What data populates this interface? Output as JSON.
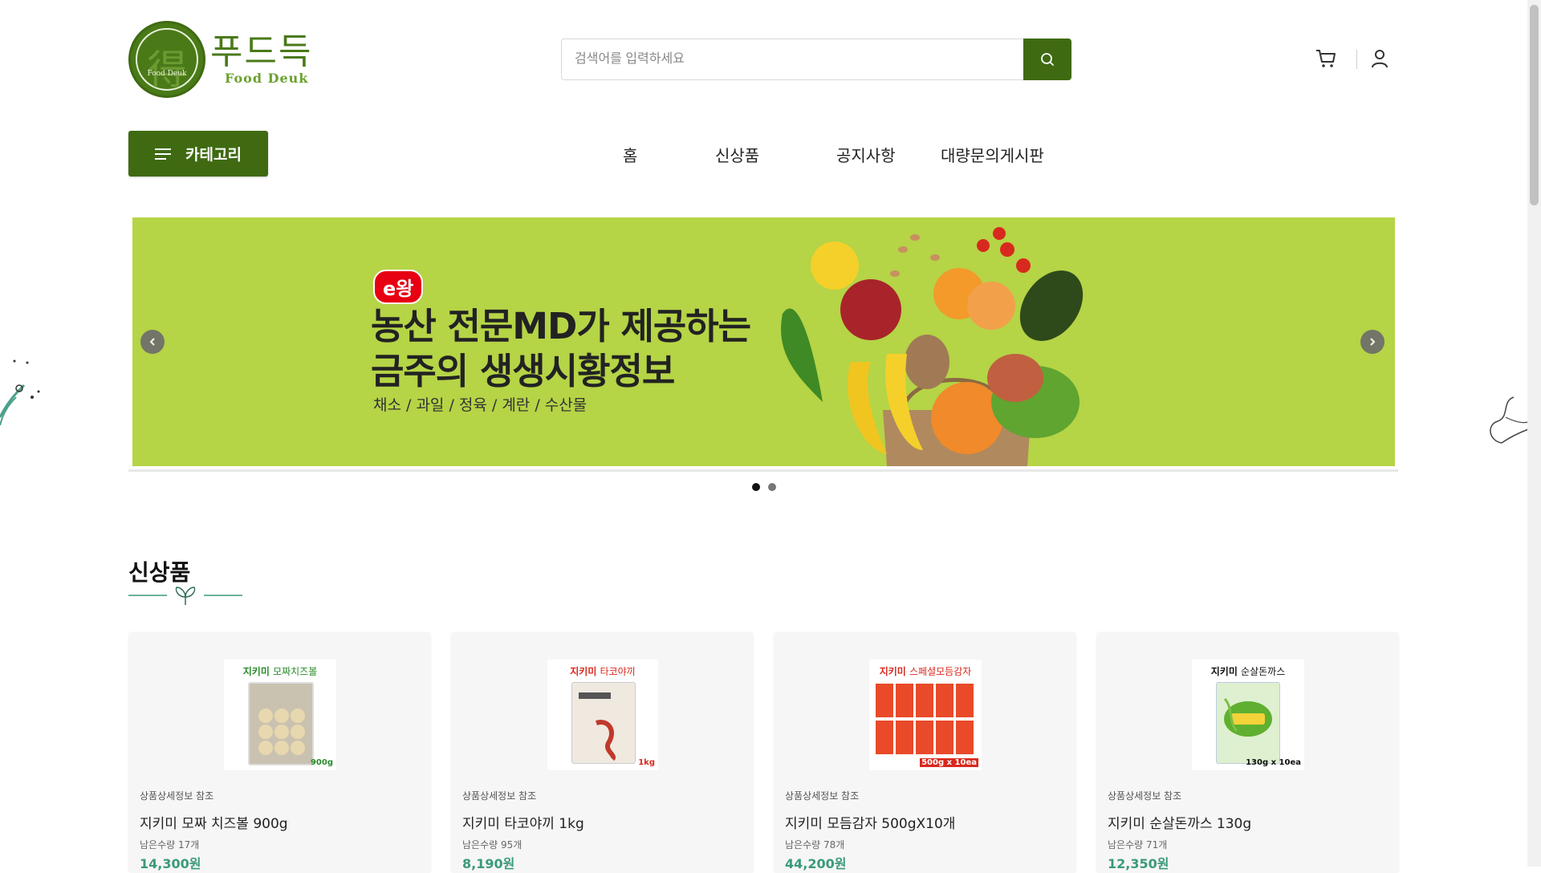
{
  "logo": {
    "korean": "푸드득",
    "english": "Food Deuk",
    "glyph": "得",
    "mini": "Food Deuk"
  },
  "search": {
    "placeholder": "검색어를 입력하세요",
    "value": ""
  },
  "icons": {
    "search": "search-icon",
    "cart": "cart-icon",
    "user": "user-icon",
    "menu": "menu-icon"
  },
  "nav": {
    "category_label": "카테고리",
    "items": [
      {
        "label": "홈"
      },
      {
        "label": "신상품"
      },
      {
        "label": "공지사항"
      },
      {
        "label": "대량문의게시판"
      }
    ]
  },
  "banner": {
    "badge": "e왕",
    "headline_line1": "농산 전문MD가 제공하는",
    "headline_line2": "금주의 생생시황정보",
    "subline": "채소 / 과일 / 정육 / 계란 / 수산물",
    "slide_count": 2,
    "active_slide": 1
  },
  "section": {
    "title": "신상품"
  },
  "products": [
    {
      "brand": "지키미",
      "brand_rest": "모짜치즈볼",
      "spec": "900g",
      "note": "상품상세정보 참조",
      "name": "지키미 모짜 치즈볼 900g",
      "stock": "남은수량 17개",
      "price": "14,300원"
    },
    {
      "brand": "지키미",
      "brand_rest": "타코야끼",
      "spec": "1kg",
      "note": "상품상세정보 참조",
      "name": "지키미 타코야끼 1kg",
      "stock": "남은수량 95개",
      "price": "8,190원"
    },
    {
      "brand": "지키미",
      "brand_rest": "스페셜모듬감자",
      "spec": "500g x 10ea",
      "note": "상품상세정보 참조",
      "name": "지키미 모듬감자 500gX10개",
      "stock": "남은수량 78개",
      "price": "44,200원"
    },
    {
      "brand": "지키미",
      "brand_rest": "순살돈까스",
      "spec": "130g x 10ea",
      "note": "상품상세정보 참조",
      "name": "지키미 순살돈까스 130g",
      "stock": "남은수량 71개",
      "price": "12,350원"
    }
  ],
  "colors": {
    "brand_green": "#3f6a12",
    "banner_bg": "#b5d446",
    "price": "#3a9a7a",
    "badge_red": "#e60012"
  }
}
